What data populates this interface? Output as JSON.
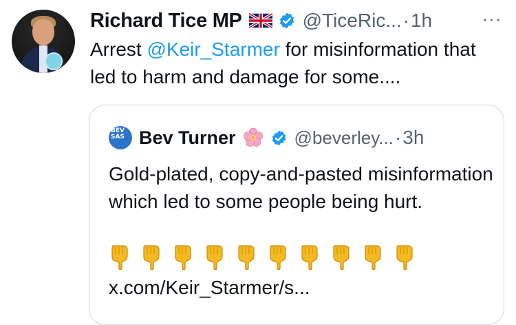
{
  "tweet": {
    "author_name": "Richard Tice MP",
    "handle": "@TiceRic...",
    "separator": "·",
    "time": "1h",
    "more_label": "···",
    "text_prefix": "Arrest ",
    "mention": "@Keir_Starmer",
    "text_suffix": " for  misinformation that led to harm and damage for some...."
  },
  "quote": {
    "author_name": "Bev Turner",
    "avatar_text": "BEV\nSAS",
    "handle": "@beverley...",
    "separator": "·",
    "time": "3h",
    "text": "Gold-plated, copy-and-pasted misinformation which led to some people being hurt.",
    "emoji_count": 10,
    "link": "x.com/Keir_Starmer/s..."
  },
  "icons": {
    "flag": "uk-flag-icon",
    "verified": "verified-badge-icon",
    "flower": "cherry-blossom-icon",
    "pointing": "backhand-index-pointing-down-icon"
  },
  "colors": {
    "accent": "#1d9bf0",
    "secondary_text": "#536471",
    "border": "#cfd9de"
  }
}
